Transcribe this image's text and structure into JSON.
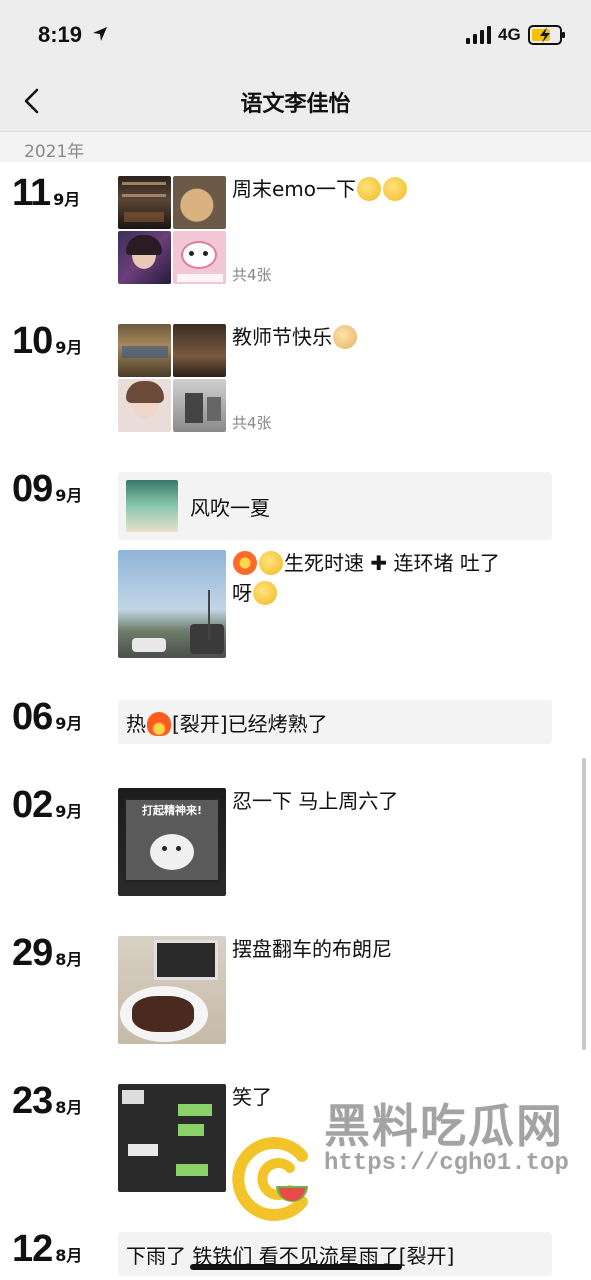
{
  "status_bar": {
    "time": "8:19",
    "network": "4G"
  },
  "nav": {
    "title": "语文李佳怡"
  },
  "year": "2021年",
  "entries": [
    {
      "day": "11",
      "month": "9月",
      "caption": "周末emo一下",
      "emoji": [
        "face-palm-emoji",
        "upside-down-face-emoji"
      ],
      "photo_count": "共4张"
    },
    {
      "day": "10",
      "month": "9月",
      "caption": "教师节快乐",
      "emoji": [
        "doge-emoji"
      ],
      "photo_count": "共4张"
    },
    {
      "day": "09",
      "month": "9月",
      "shared_title": "风吹一夏",
      "caption": "生死时速",
      "caption2": "连环堵 吐了",
      "caption3": "呀",
      "emoji": [
        "collision-emoji",
        "exploding-head-emoji",
        "plus-emoji",
        "crying-face-emoji"
      ]
    },
    {
      "day": "06",
      "month": "9月",
      "text": "热",
      "text2": "[裂开]已经烤熟了",
      "emoji": [
        "fire-emoji"
      ]
    },
    {
      "day": "02",
      "month": "9月",
      "caption": "忍一下 马上周六了",
      "image_text": "打起精神来!"
    },
    {
      "day": "29",
      "month": "8月",
      "caption": "摆盘翻车的布朗尼"
    },
    {
      "day": "23",
      "month": "8月",
      "caption": "笑了"
    },
    {
      "day": "12",
      "month": "8月",
      "text": "下雨了 铁铁们 看不见流星雨了[裂开]"
    }
  ],
  "watermark": {
    "title": "黑料吃瓜网",
    "url": "https://cgh01.top"
  },
  "colors": {
    "nav_bg": "#ededed",
    "card_bg": "#f3f3f3",
    "muted": "#888888"
  }
}
